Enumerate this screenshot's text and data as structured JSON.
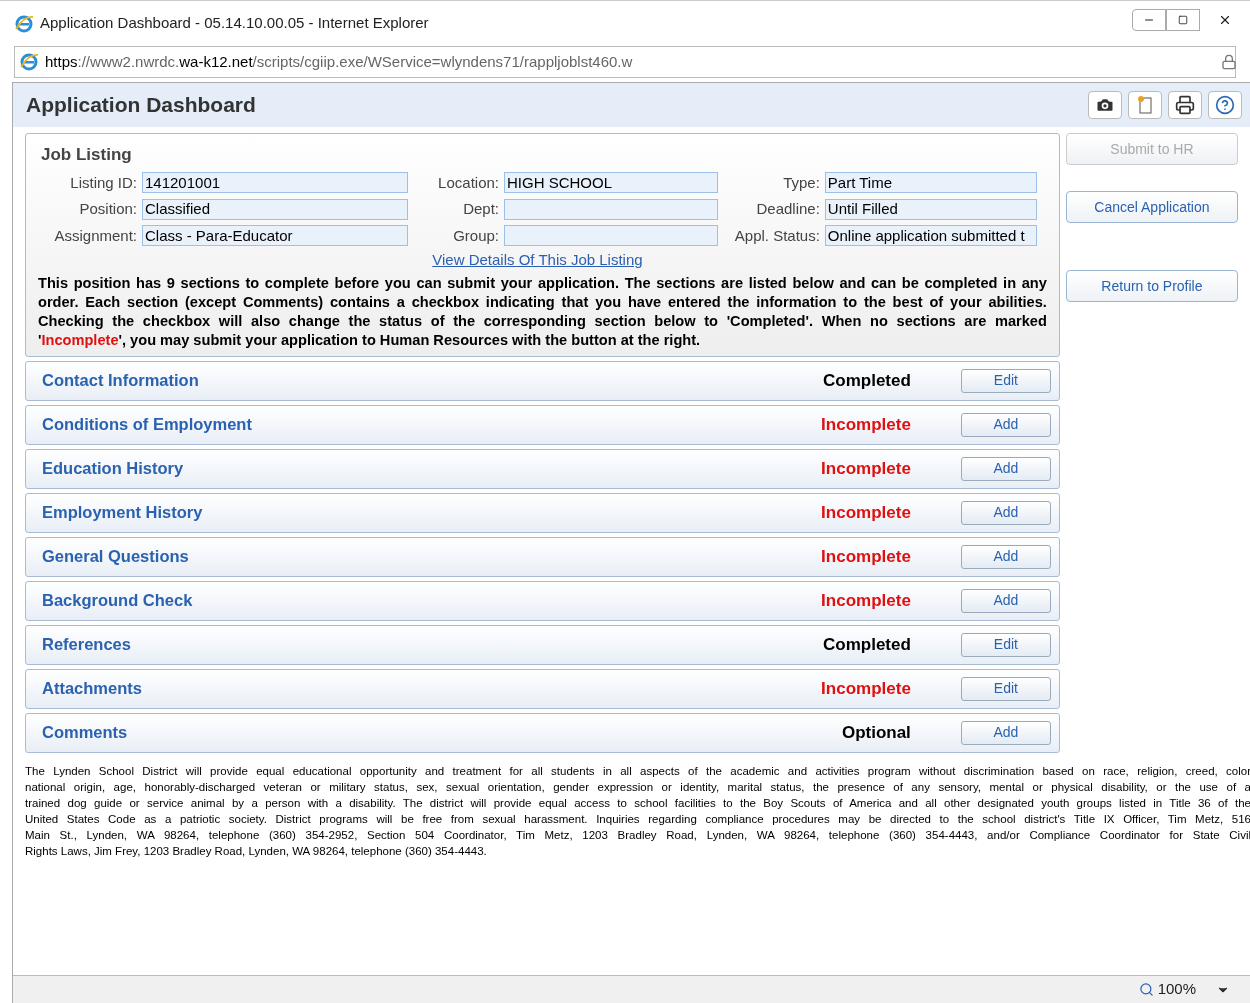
{
  "window": {
    "title": "Application Dashboard - 05.14.10.00.05 - Internet Explorer"
  },
  "address_bar": {
    "url_prefix": "https://www2.nwrdc.",
    "url_domain": "wa-k12.net",
    "url_path": "/scripts/cgiip.exe/WService=wlyndens71/rappljoblst460.w"
  },
  "page_title": "Application Dashboard",
  "job_listing": {
    "title": "Job Listing",
    "fields": [
      {
        "label": "Listing ID:",
        "value": "141201001"
      },
      {
        "label": "Location:",
        "value": "HIGH SCHOOL"
      },
      {
        "label": "Type:",
        "value": "Part Time"
      },
      {
        "label": "Position:",
        "value": "Classified"
      },
      {
        "label": "Dept:"
      },
      {
        "label": "Deadline:",
        "value": "Until Filled"
      },
      {
        "label": "Assignment:",
        "value": "Class - Para-Educator"
      },
      {
        "label": "Group:"
      },
      {
        "label": "Appl. Status:",
        "value": "Online application submitted t"
      }
    ],
    "details_link": "View Details Of This Job Listing",
    "instructions": [
      "This position has 9 sections to complete before you can submit your application. The sections are listed below and can be completed in any order. Each section (except Comments) contains a checkbox indicating that you have entered the information to the best of your abilities. Checking the checkbox will also change the status of the corresponding section below to 'Completed'. When no sections are marked '",
      "Incomplete",
      "', you may submit your application to Human Resources with the button at the right."
    ]
  },
  "sections": [
    {
      "name": "Contact Information",
      "status": "Completed",
      "kind": "completed",
      "button": "Edit"
    },
    {
      "name": "Conditions of Employment",
      "status": "Incomplete",
      "kind": "incomplete",
      "button": "Add"
    },
    {
      "name": "Education History",
      "status": "Incomplete",
      "kind": "incomplete",
      "button": "Add"
    },
    {
      "name": "Employment History",
      "status": "Incomplete",
      "kind": "incomplete",
      "button": "Add"
    },
    {
      "name": "General Questions",
      "status": "Incomplete",
      "kind": "incomplete",
      "button": "Add"
    },
    {
      "name": "Background Check",
      "status": "Incomplete",
      "kind": "incomplete",
      "button": "Add"
    },
    {
      "name": "References",
      "status": "Completed",
      "kind": "completed",
      "button": "Edit"
    },
    {
      "name": "Attachments",
      "status": "Incomplete",
      "kind": "incomplete",
      "button": "Edit"
    },
    {
      "name": "Comments",
      "status": "Optional",
      "kind": "optional",
      "button": "Add"
    }
  ],
  "side_buttons": [
    {
      "label": "Submit to HR",
      "disabled": true
    },
    {
      "label": "Cancel Application",
      "disabled": false
    },
    {
      "label": "Return to Profile",
      "disabled": false
    }
  ],
  "footer_lines": [
    "The Lynden School District will provide equal educational opportunity and treatment for all students in all aspects of the academic and activities program without discrimination based on race, religion, creed, color",
    "national origin, age, honorably-discharged veteran or military status, sex, sexual orientation, gender expression or identity, marital status, the presence of any sensory, mental or physical disability, or the use of a",
    "trained dog guide or service animal by a person with a disability. The district will provide equal access to school facilities to the Boy Scouts of America and all other designated youth groups listed in Title 36 of the",
    "United States Code as a patriotic society. District programs will be free from sexual harassment. Inquiries regarding compliance procedures may be directed to the school district's Title IX Officer, Tim Metz, 516",
    "Main St., Lynden, WA 98264, telephone (360) 354-2952, Section 504 Coordinator, Tim Metz, 1203 Bradley Road, Lynden, WA 98264, telephone (360) 354-4443, and/or Compliance Coordinator for State Civil",
    "Rights Laws, Jim Frey, 1203 Bradley Road, Lynden, WA 98264, telephone (360) 354-4443."
  ],
  "status_bar": {
    "zoom": "100%"
  }
}
